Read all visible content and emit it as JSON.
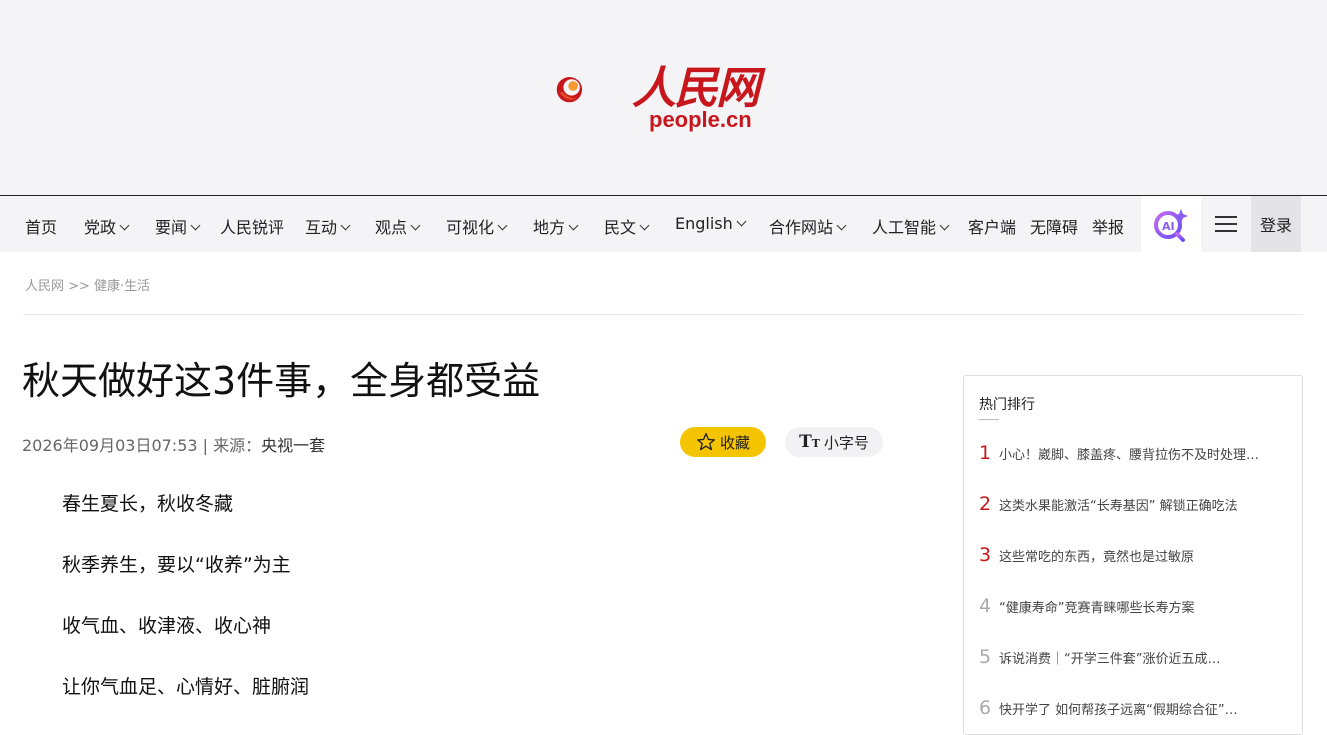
{
  "logo": {
    "name": "人民网",
    "domain": "people.cn"
  },
  "nav": {
    "items": [
      {
        "label": "首页",
        "dropdown": false
      },
      {
        "label": "党政",
        "dropdown": true
      },
      {
        "label": "要闻",
        "dropdown": true
      },
      {
        "label": "人民锐评",
        "dropdown": false
      },
      {
        "label": "互动",
        "dropdown": true
      },
      {
        "label": "观点",
        "dropdown": true
      },
      {
        "label": "可视化",
        "dropdown": true
      },
      {
        "label": "地方",
        "dropdown": true
      },
      {
        "label": "民文",
        "dropdown": true
      },
      {
        "label": "English",
        "dropdown": true
      },
      {
        "label": "合作网站",
        "dropdown": true
      },
      {
        "label": "人工智能",
        "dropdown": true
      },
      {
        "label": "客户端",
        "dropdown": false
      },
      {
        "label": "无障碍",
        "dropdown": false
      },
      {
        "label": "举报",
        "dropdown": false
      }
    ],
    "login_label": "登录",
    "ai_icon": "ai-search-icon",
    "menu_icon": "hamburger-icon"
  },
  "breadcrumb": "人民网 >> 健康·生活",
  "article": {
    "title": "秋天做好这3件事，全身都受益",
    "date": "2026年09月03日07:53",
    "source_prefix": " | 来源：",
    "source": "央视一套",
    "fav_label": "收藏",
    "font_label": "小字号",
    "paragraphs": [
      "春生夏长，秋收冬藏",
      "秋季养生，要以“收养”为主",
      "收气血、收津液、收心神",
      "让你气血足、心情好、脏腑润"
    ]
  },
  "sidebar": {
    "title": "热门排行",
    "items": [
      {
        "rank": "1",
        "text": "小心！崴脚、膝盖疼、腰背拉伤不及时处理…"
      },
      {
        "rank": "2",
        "text": "这类水果能激活“长寿基因” 解锁正确吃法"
      },
      {
        "rank": "3",
        "text": "这些常吃的东西，竟然也是过敏原"
      },
      {
        "rank": "4",
        "text": "“健康寿命”竞赛青睐哪些长寿方案"
      },
      {
        "rank": "5",
        "text": "诉说消费｜“开学三件套”涨价近五成…"
      },
      {
        "rank": "6",
        "text": "快开学了 如何帮孩子远离“假期综合征”…"
      }
    ]
  },
  "colors": {
    "brand": "#c8161d",
    "fav_bg": "#f5c400"
  }
}
